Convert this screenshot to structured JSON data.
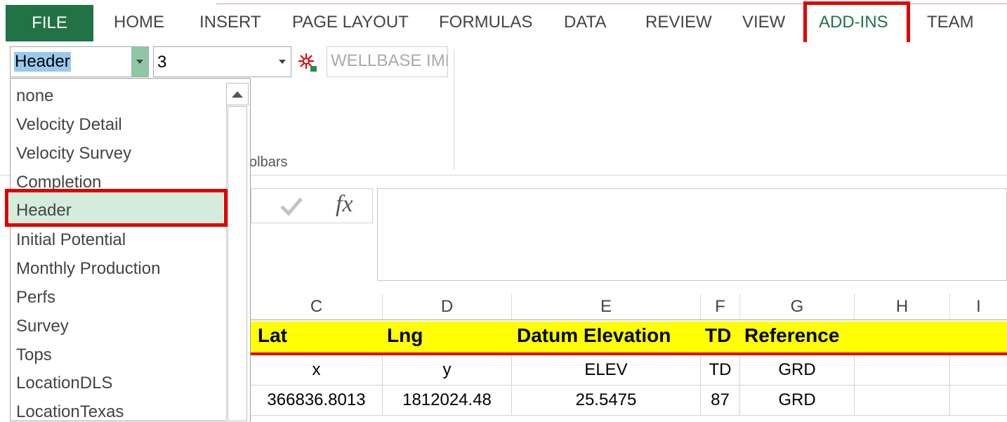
{
  "tabs": {
    "file": "FILE",
    "home": "HOME",
    "insert": "INSERT",
    "page_layout": "PAGE LAYOUT",
    "formulas": "FORMULAS",
    "data": "DATA",
    "review": "REVIEW",
    "view": "VIEW",
    "add_ins": "ADD-INS",
    "team": "TEAM"
  },
  "ribbon": {
    "type_select_value": "Header",
    "count_select_value": "3",
    "wellbase_button": "WELLBASE IMP",
    "group_label": "olbars",
    "import_icon": "red-star-import-icon"
  },
  "dropdown": {
    "items": [
      "none",
      "Velocity Detail",
      "Velocity Survey",
      "Completion",
      "Header",
      "Initial Potential",
      "Monthly Production",
      "Perfs",
      "Survey",
      "Tops",
      "LocationDLS",
      "LocationTexas"
    ],
    "selected": "Header"
  },
  "formula_bar": {
    "fx": "fx",
    "value": ""
  },
  "sheet": {
    "columns": [
      "C",
      "D",
      "E",
      "F",
      "G",
      "H",
      "I"
    ],
    "header_row": [
      "Lat",
      "Lng",
      "Datum Elevation",
      "TD",
      "Reference"
    ],
    "row2": [
      "x",
      "y",
      "ELEV",
      "TD",
      "GRD",
      "",
      ""
    ],
    "row3": [
      "366836.8013",
      "1812024.48",
      "25.5475",
      "87",
      "GRD",
      "",
      ""
    ]
  },
  "colors": {
    "file_tab_bg": "#217346",
    "active_tab_text": "#217346",
    "highlight_box": "#e00000",
    "header_fill": "#ffff00",
    "selected_item_bg": "#d3ecdc"
  }
}
